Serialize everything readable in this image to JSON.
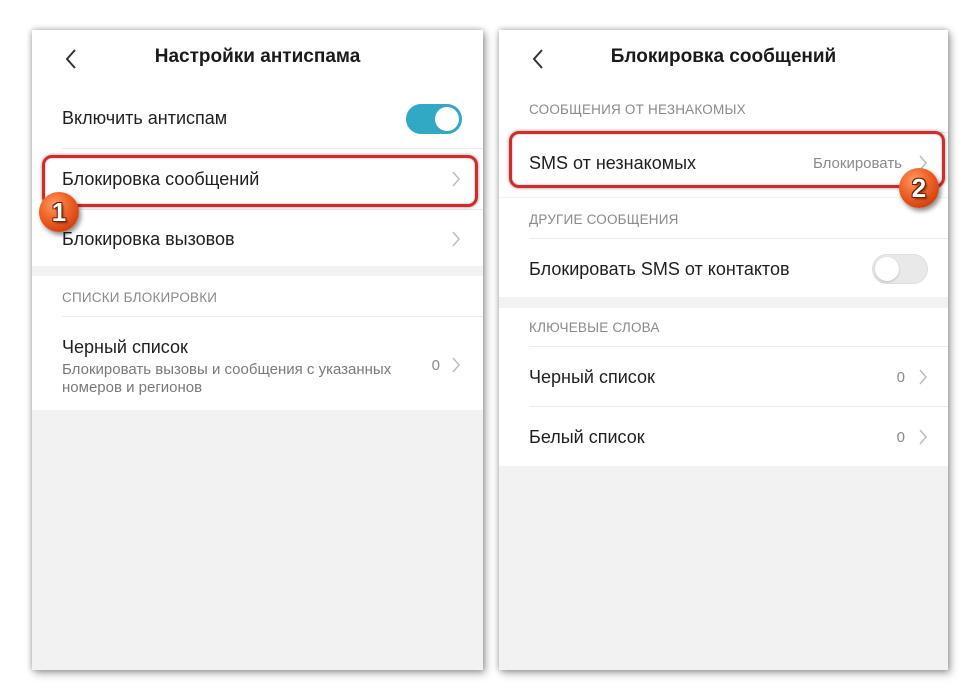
{
  "left": {
    "title": "Настройки антиспама",
    "enable_antispam": {
      "label": "Включить антиспам",
      "enabled": true
    },
    "block_messages": {
      "label": "Блокировка сообщений"
    },
    "block_calls": {
      "label": "Блокировка вызовов"
    },
    "section_block_lists": "СПИСКИ БЛОКИРОВКИ",
    "blacklist": {
      "label": "Черный список",
      "description_line1": "Блокировать вызовы и сообщения с указанных",
      "description_line2": "номеров и регионов",
      "count": "0"
    },
    "step_badge": "1"
  },
  "right": {
    "title": "Блокировка сообщений",
    "section_unknown": "СООБЩЕНИЯ ОТ НЕЗНАКОМЫХ",
    "sms_unknown": {
      "label": "SMS от незнакомых",
      "value": "Блокировать"
    },
    "section_other": "ДРУГИЕ СООБЩЕНИЯ",
    "block_sms_contacts": {
      "label": "Блокировать SMS от контактов",
      "enabled": false
    },
    "section_keywords": "КЛЮЧЕВЫЕ СЛОВА",
    "blacklist": {
      "label": "Черный список",
      "count": "0"
    },
    "whitelist": {
      "label": "Белый список",
      "count": "0"
    },
    "step_badge": "2"
  },
  "colors": {
    "toggle_on": "#31a8c4",
    "highlight": "#d42a2a",
    "badge": "#f36a2d"
  }
}
